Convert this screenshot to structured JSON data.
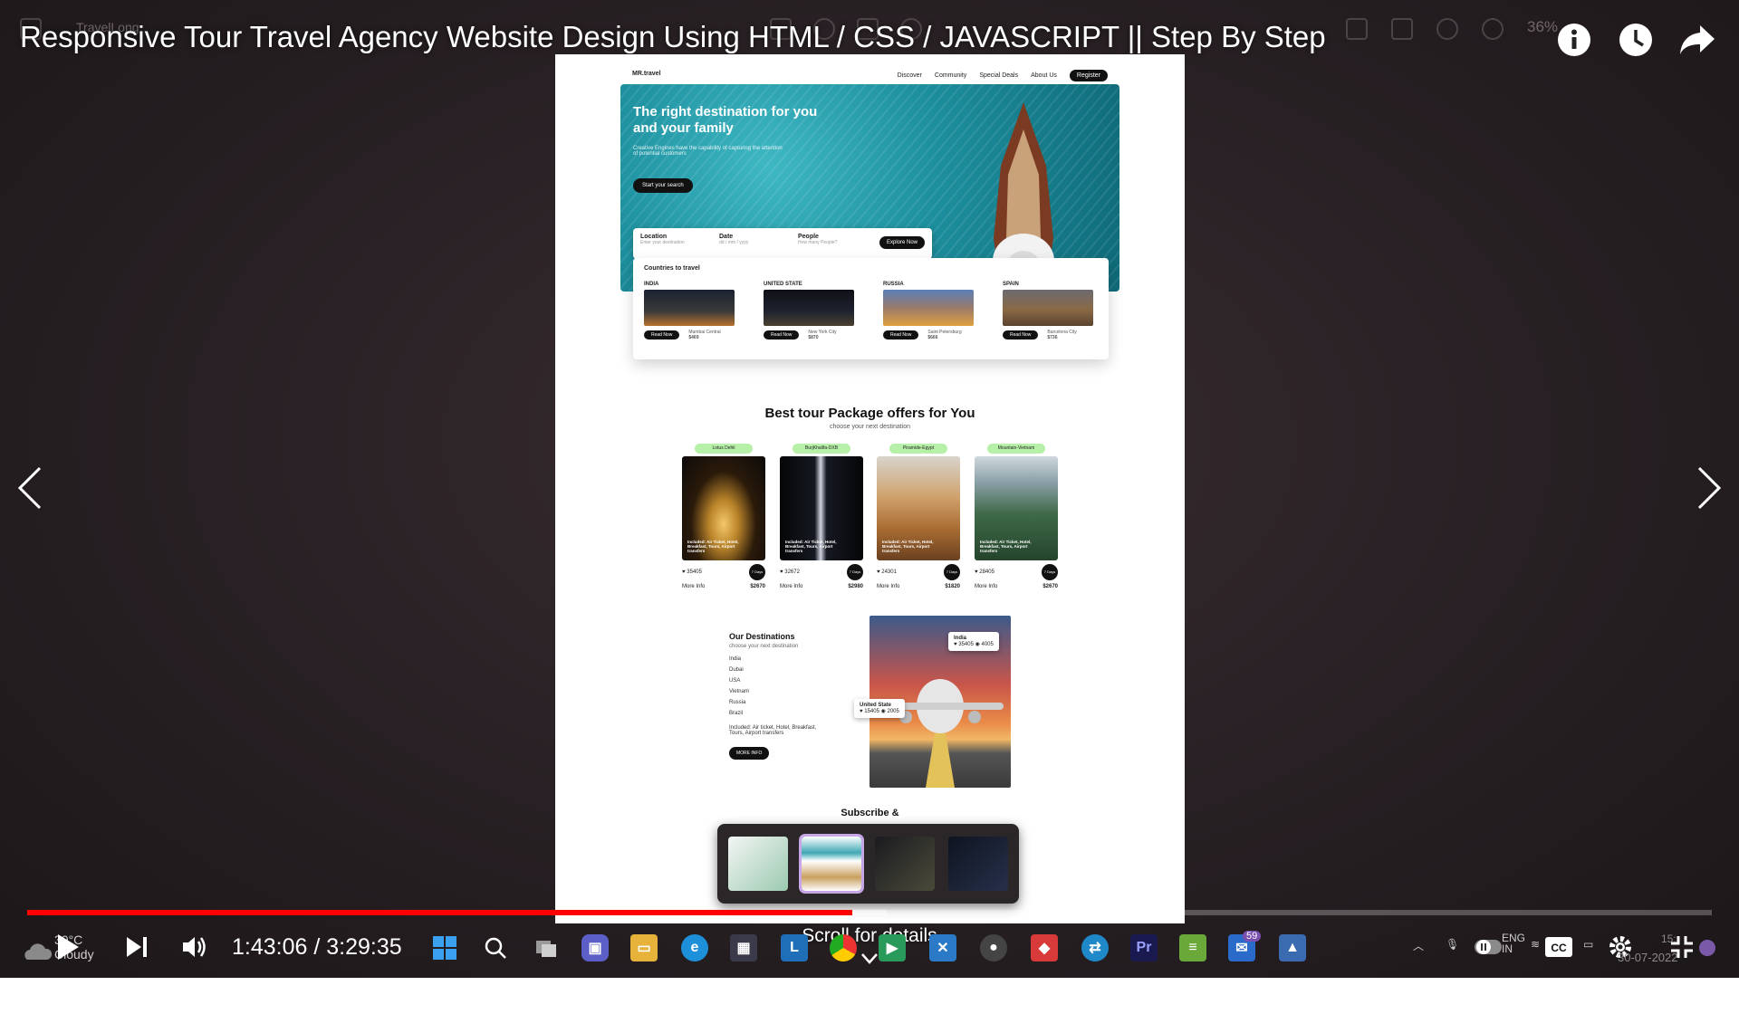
{
  "viewer": {
    "app_name": "TravelLong",
    "zoom": "36%"
  },
  "video": {
    "title": "Responsive Tour Travel Agency Website Design Using HTML / CSS / JAVASCRIPT || Step By Step",
    "current_time": "1:43:06",
    "duration": "3:29:35",
    "time_display": "1:43:06 / 3:29:35",
    "progress": 0.49,
    "buffered": 0.51,
    "scroll_hint": "Scroll for details"
  },
  "site": {
    "logo": "MR.travel",
    "nav": [
      "Discover",
      "Community",
      "Special Deals",
      "About Us"
    ],
    "register": "Register",
    "hero_title": "The right destination for you and your family",
    "hero_sub": "Creative Engines have the capability of capturing the attention of potential customers",
    "hero_cta": "Start your search",
    "search": {
      "location_label": "Location",
      "location_ph": "Enter your destination",
      "date_label": "Date",
      "date_ph": "dd / mm / yyyy",
      "people_label": "People",
      "people_ph": "How many People?",
      "explore": "Explore Now"
    },
    "countries_title": "Countries to travel",
    "countries": [
      {
        "name": "INDIA",
        "city": "Mumbai Central",
        "price": "$469",
        "btn": "Read Now"
      },
      {
        "name": "UNITED STATE",
        "city": "New York City",
        "price": "$870",
        "btn": "Read Now"
      },
      {
        "name": "RUSSIA",
        "city": "Saint Petersburg",
        "price": "$666",
        "btn": "Read Now"
      },
      {
        "name": "SPAIN",
        "city": "Barcelona City",
        "price": "$736",
        "btn": "Read Now"
      }
    ],
    "packages_title": "Best tour Package offers for You",
    "packages_sub": "choose your next destination",
    "packages": [
      {
        "tag": "Lotus Dehli",
        "caption": "Included: Air Ticket, Hotel, Breakfast, Tours, Airport transfers",
        "likes": "35405",
        "views": "40560",
        "more": "More Info",
        "price": "$2670",
        "days": "7 Days"
      },
      {
        "tag": "BurjKhalifa-DXB",
        "caption": "Included: Air Ticket, Hotel, Breakfast, Tours, Airport transfers",
        "likes": "32672",
        "views": "8571",
        "more": "More Info",
        "price": "$2980",
        "days": "7 Days"
      },
      {
        "tag": "Piramide-Egypt",
        "caption": "Included: Air Ticket, Hotel, Breakfast, Tours, Airport transfers",
        "likes": "24301",
        "views": "2289",
        "more": "More Info",
        "price": "$1820",
        "days": "7 Days"
      },
      {
        "tag": "Mountain-Vietnam",
        "caption": "Included: Air Ticket, Hotel, Breakfast, Tours, Airport transfers",
        "likes": "28405",
        "views": "40166",
        "more": "More Info",
        "price": "$2670",
        "days": "7 Days"
      }
    ],
    "dest_title": "Our Destinations",
    "dest_sub": "choose your next destination",
    "dest_list": [
      "India",
      "Dubai",
      "USA",
      "Vietnam",
      "Russia",
      "Brazil"
    ],
    "dest_included": "Included: Air ticket, Hotel, Breakfast, Tours, Airport transfers",
    "dest_more": "MORE INFO",
    "popup_india": {
      "name": "India",
      "likes": "35405",
      "views": "4005"
    },
    "popup_us": {
      "name": "United State",
      "likes": "15405",
      "views": "2005"
    },
    "subscribe": "Subscribe &"
  },
  "taskbar": {
    "weather_temp": "30°C",
    "weather_desc": "Cloudy",
    "badge": "59",
    "lang": "ENG",
    "region": "IN",
    "clock": "15:",
    "date": "30-07-2022"
  },
  "colors": {
    "progress_red": "#ff0000",
    "package_tag": "#b7f0a8",
    "thumb_selected": "#c7a6e8"
  }
}
